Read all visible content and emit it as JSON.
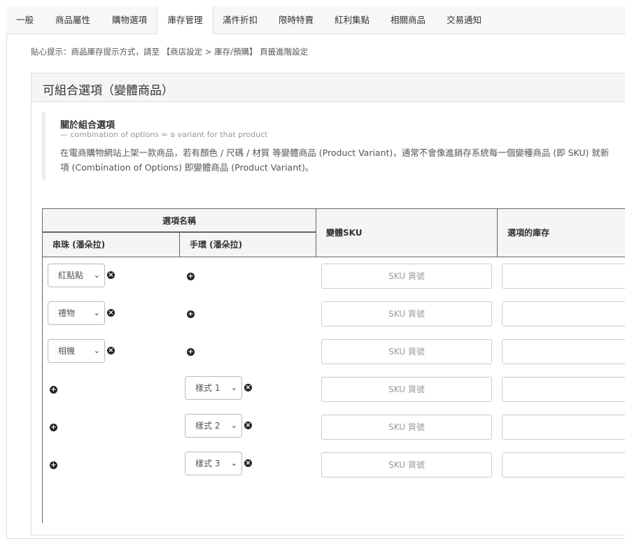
{
  "tabs": [
    "一般",
    "商品屬性",
    "購物選項",
    "庫存管理",
    "滿件折扣",
    "限時特賣",
    "紅利集點",
    "相關商品",
    "交易通知"
  ],
  "active_tab": "庫存管理",
  "hint": "貼心提示：商品庫存提示方式，請至 【商店設定 > 庫存/預購】 頁籤進階設定",
  "panel_title": "可組合選項（變體商品）",
  "note": {
    "title": "關於組合選項",
    "subtitle": "— combination of options = a variant for that product",
    "line1": "在電商購物網站上架一款商品，若有顏色 / 尺碼 / 材質 等變體商品 (Product Variant)，通常不會像進銷存系統每一個變種商品 (即 SKU) 就新",
    "line2": "項 (Combination of Options) 即變體商品 (Product Variant)。"
  },
  "table": {
    "group_header": "選項名稱",
    "col1": "串珠 (潘朵拉)",
    "col2": "手環 (潘朵拉)",
    "col3": "變體SKU",
    "col4": "選項的庫存",
    "sku_placeholder": "SKU 貨號",
    "rows": [
      {
        "col1": "紅點點",
        "col2": ""
      },
      {
        "col1": "禮物",
        "col2": ""
      },
      {
        "col1": "相機",
        "col2": ""
      },
      {
        "col1": "",
        "col2": "樣式 1"
      },
      {
        "col1": "",
        "col2": "樣式 2"
      },
      {
        "col1": "",
        "col2": "樣式 3"
      }
    ]
  },
  "icons": {
    "add": "plus-circle-icon",
    "remove": "x-circle-icon",
    "dropdown": "chevron-down-icon"
  }
}
